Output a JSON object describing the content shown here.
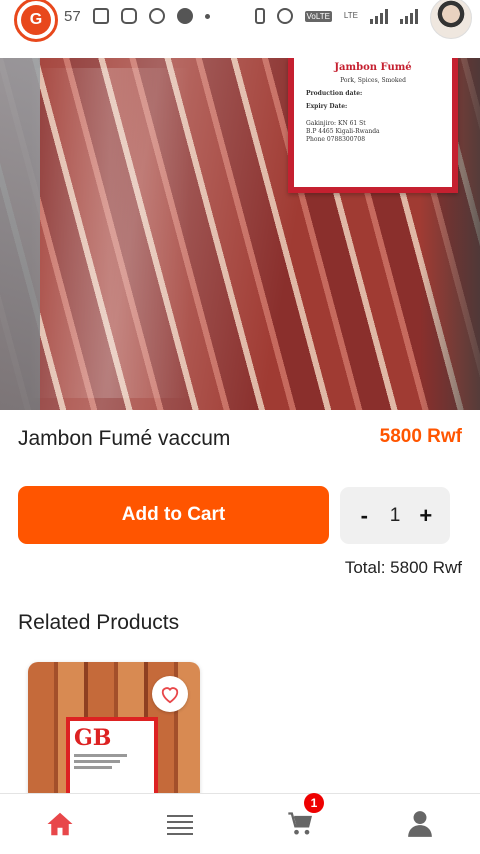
{
  "status_bar": {
    "time": "57",
    "volte_label": "VoLTE",
    "lte_label": "LTE"
  },
  "product": {
    "name": "Jambon Fumé vaccum",
    "price": "5800 Rwf",
    "image_label": {
      "title": "Jambon Fumé",
      "subtitle": "Pork, Spices, Smoked",
      "production": "Production date:",
      "expiry": "Expiry Date:",
      "address_line1": "Gakinjiro: KN 61 St",
      "address_line2": "B.P 4465 Kigali-Rwanda",
      "phone": "Phone 0788300708"
    }
  },
  "actions": {
    "add_to_cart_label": "Add to Cart",
    "decrement_label": "-",
    "quantity": "1",
    "increment_label": "+"
  },
  "total": "Total: 5800 Rwf",
  "related": {
    "title": "Related Products",
    "items": [
      {
        "label_text": "GB"
      }
    ]
  },
  "bottom_nav": {
    "items": [
      {
        "icon": "home-icon",
        "active": true
      },
      {
        "icon": "menu-list-icon",
        "active": false
      },
      {
        "icon": "cart-icon",
        "active": false,
        "badge": "1"
      },
      {
        "icon": "user-icon",
        "active": false
      }
    ]
  },
  "colors": {
    "accent": "#ff5500",
    "badge": "#e00000",
    "active_nav": "#e8474a",
    "inactive_nav": "#666666"
  }
}
